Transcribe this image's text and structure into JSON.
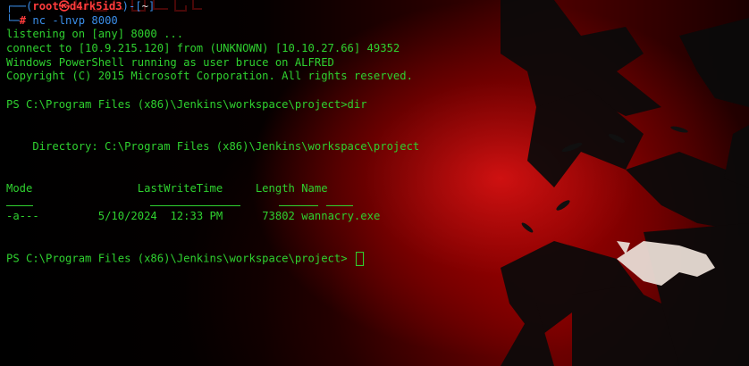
{
  "terminal": {
    "prompt_user": "root",
    "prompt_at": "㉿",
    "prompt_host": "d4rk5id3",
    "prompt_dir": "~",
    "prompt_hash": "#",
    "command": "nc -lnvp 8000",
    "line_listening": "listening on [any] 8000 ...",
    "line_connect": "connect to [10.9.215.120] from (UNKNOWN) [10.10.27.66] 49352",
    "line_ps_banner": "Windows PowerShell running as user bruce on ALFRED",
    "line_copyright": "Copyright (C) 2015 Microsoft Corporation. All rights reserved.",
    "ps_prompt_dir": "PS C:\\Program Files (x86)\\Jenkins\\workspace\\project>dir",
    "directory_line": "    Directory: C:\\Program Files (x86)\\Jenkins\\workspace\\project",
    "table": {
      "headers": {
        "mode": "Mode",
        "last_write_time": "LastWriteTime",
        "length": "Length",
        "name": "Name"
      },
      "rows": [
        {
          "mode": "-a---",
          "date": "5/10/2024",
          "time": "12:33 PM",
          "length": "73802",
          "name": "wannacry.exe"
        }
      ]
    },
    "ps_prompt_final": "PS C:\\Program Files (x86)\\Jenkins\\workspace\\project> "
  },
  "colors": {
    "text_green": "#2fd12f",
    "prompt_blue": "#3b8eea",
    "prompt_red": "#ff3c3c",
    "background": "#000000"
  }
}
